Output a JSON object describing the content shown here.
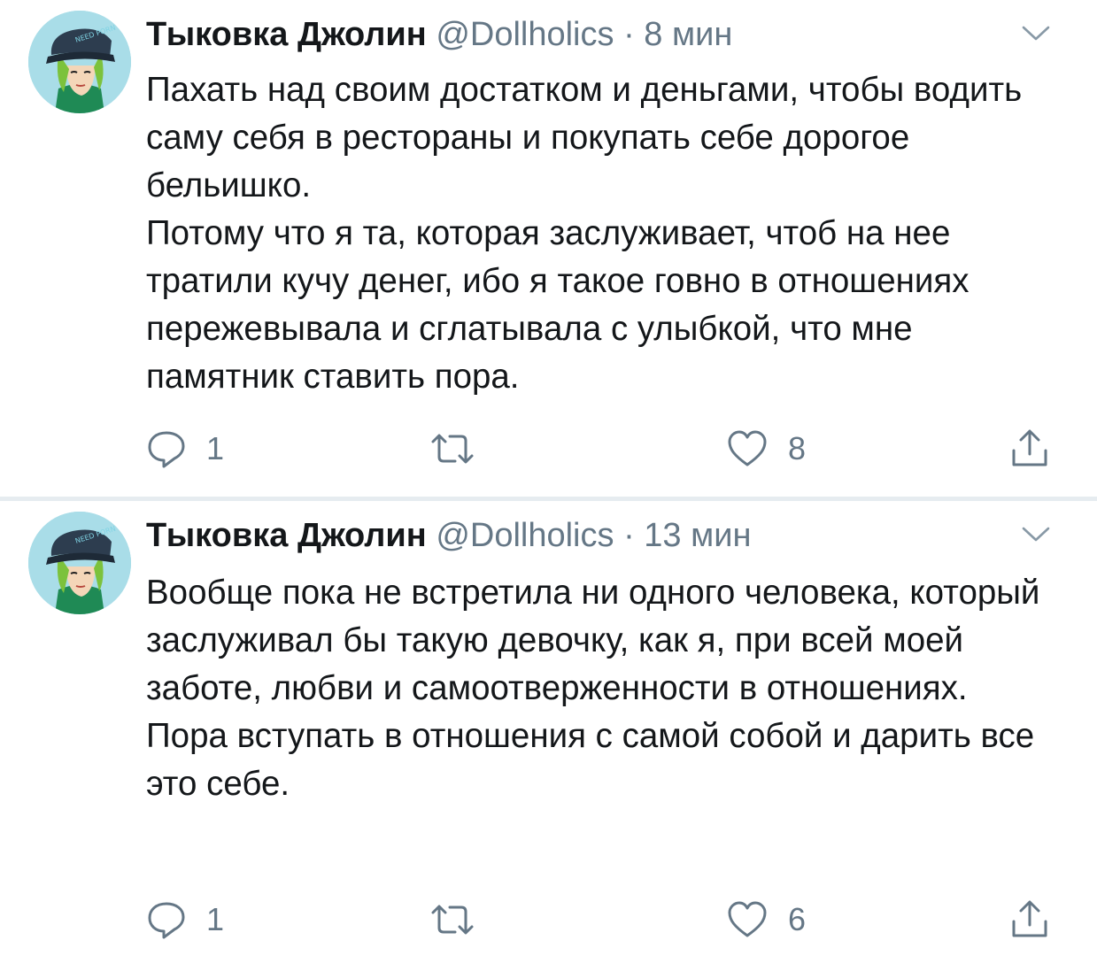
{
  "tweets": [
    {
      "author_name": "Тыковка Джолин",
      "handle": "@Dollholics",
      "separator": "·",
      "time": "8 мин",
      "text": "Пахать над своим достатком и деньгами, чтобы водить саму себя в рестораны и покупать себе дорогое бельишко.\nПотому что я та, которая заслуживает, чтоб на нее тратили кучу денег, ибо я такое говно в отношениях пережевывала и сглатывала с улыбкой, что мне памятник ставить пора.",
      "replies": "1",
      "retweets": "",
      "likes": "8",
      "avatar_cap_text": "NEED PORN"
    },
    {
      "author_name": "Тыковка Джолин",
      "handle": "@Dollholics",
      "separator": "·",
      "time": "13 мин",
      "text": "Вообще пока не встретила ни одного человека, который заслуживал бы такую девочку, как я, при всей моей заботе, любви и самоотверженности в отношениях.\nПора вступать в отношения с самой собой и дарить все это себе.",
      "replies": "1",
      "retweets": "",
      "likes": "6",
      "avatar_cap_text": "NEED PORN"
    }
  ],
  "icons": {
    "reply": "speech-bubble-icon",
    "retweet": "retweet-arrows-icon",
    "like": "heart-icon",
    "share": "share-upload-icon",
    "menu": "chevron-down-icon"
  },
  "colors": {
    "text_primary": "#14171a",
    "text_secondary": "#657786",
    "divider": "#e6ecf0",
    "background": "#ffffff"
  }
}
